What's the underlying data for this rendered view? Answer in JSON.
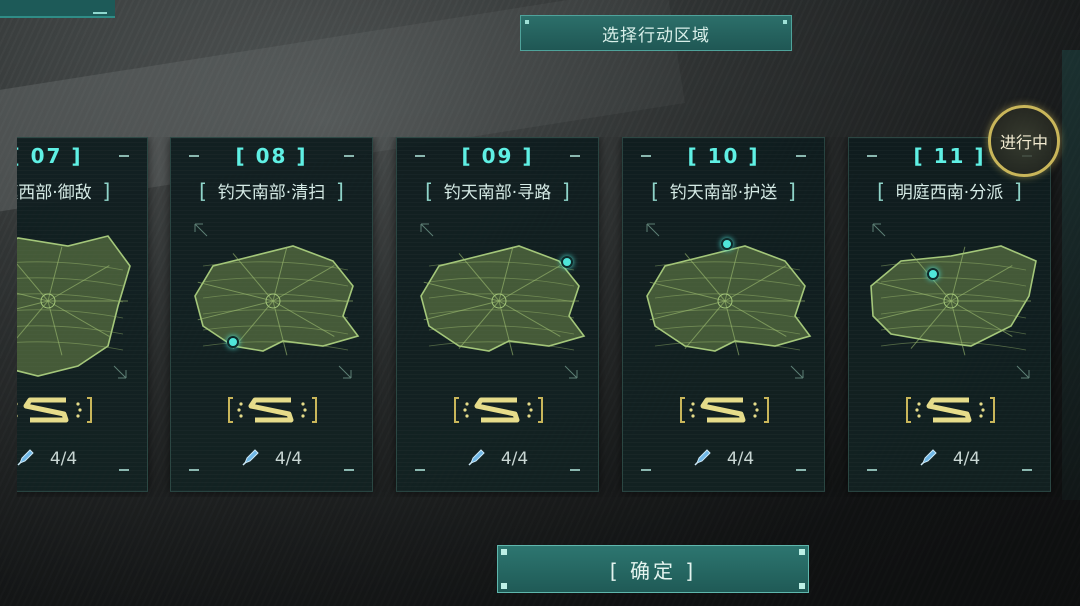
{
  "header": {
    "title": "选择行动区域"
  },
  "status_badge": {
    "label": "进行中"
  },
  "regions": [
    {
      "number": "07",
      "name": "庭西部·御敌",
      "progress": "4/4",
      "map_variant": "a",
      "marker": "left"
    },
    {
      "number": "08",
      "name": "钓天南部·清扫",
      "progress": "4/4",
      "map_variant": "b",
      "marker": "bottom-left"
    },
    {
      "number": "09",
      "name": "钓天南部·寻路",
      "progress": "4/4",
      "map_variant": "b",
      "marker": "top-right"
    },
    {
      "number": "10",
      "name": "钓天南部·护送",
      "progress": "4/4",
      "map_variant": "b",
      "marker": "top"
    },
    {
      "number": "11",
      "name": "明庭西南·分派",
      "progress": "4/4",
      "map_variant": "c",
      "marker": "top-left"
    }
  ],
  "confirm": {
    "label": "确定"
  },
  "colors": {
    "accent": "#5ff0e4",
    "map": "#6f8a4c",
    "badge": "#c9b65a",
    "button": "#2d7670"
  }
}
